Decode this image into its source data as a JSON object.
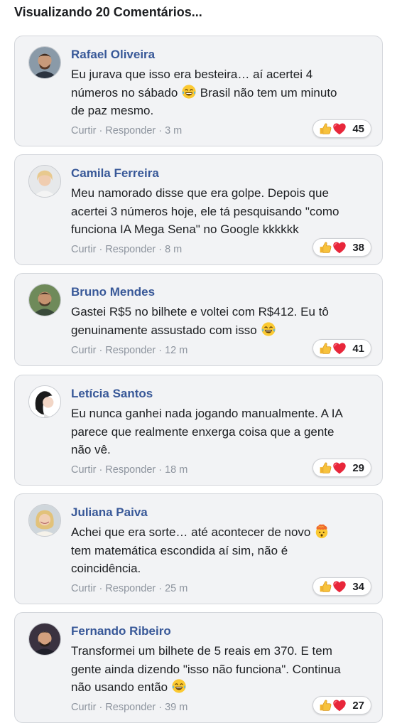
{
  "header": {
    "title": "Visualizando 20 Comentários..."
  },
  "labels": {
    "like": "Curtir",
    "reply": "Responder",
    "separator": "·"
  },
  "comments": [
    {
      "author": "Rafael Oliveira",
      "lines": [
        "Eu jurava que isso era besteira… aí acertei 4",
        "números no sábado",
        "Brasil não tem um minuto",
        "de paz mesmo."
      ],
      "time": "3 m",
      "reactions": "45",
      "emoji": "laughing-tears"
    },
    {
      "author": "Camila Ferreira",
      "lines": [
        "Meu namorado disse que era golpe. Depois que",
        "acertei 3 números hoje, ele tá pesquisando \"como",
        "funciona IA Mega Sena\" no Google kkkkkk"
      ],
      "time": "8 m",
      "reactions": "38"
    },
    {
      "author": "Bruno Mendes",
      "lines": [
        "Gastei R$5 no bilhete e voltei com R$412. Eu tô",
        "genuinamente assustado com isso"
      ],
      "time": "12 m",
      "reactions": "41",
      "emoji": "laughing-tears"
    },
    {
      "author": "Letícia Santos",
      "lines": [
        "Eu nunca ganhei nada jogando manualmente. A IA",
        "parece que realmente enxerga coisa que a gente",
        "não vê."
      ],
      "time": "18 m",
      "reactions": "29"
    },
    {
      "author": "Juliana Paiva",
      "lines": [
        "Achei que era sorte… até acontecer de novo",
        "tem matemática escondida aí sim, não é",
        "coincidência."
      ],
      "time": "25 m",
      "reactions": "34",
      "emoji": "exploding-head"
    },
    {
      "author": "Fernando Ribeiro",
      "lines": [
        "Transformei um bilhete de 5 reais em 370. E tem",
        "gente ainda dizendo \"isso não funciona\". Continua",
        "não usando então"
      ],
      "time": "39 m",
      "reactions": "27",
      "emoji": "laughing-tears"
    }
  ],
  "colors": {
    "author": "#385898",
    "meta": "#8d949e",
    "card_bg": "#f2f3f5",
    "like_blue": "#1877f2",
    "love_red": "#f02849"
  }
}
